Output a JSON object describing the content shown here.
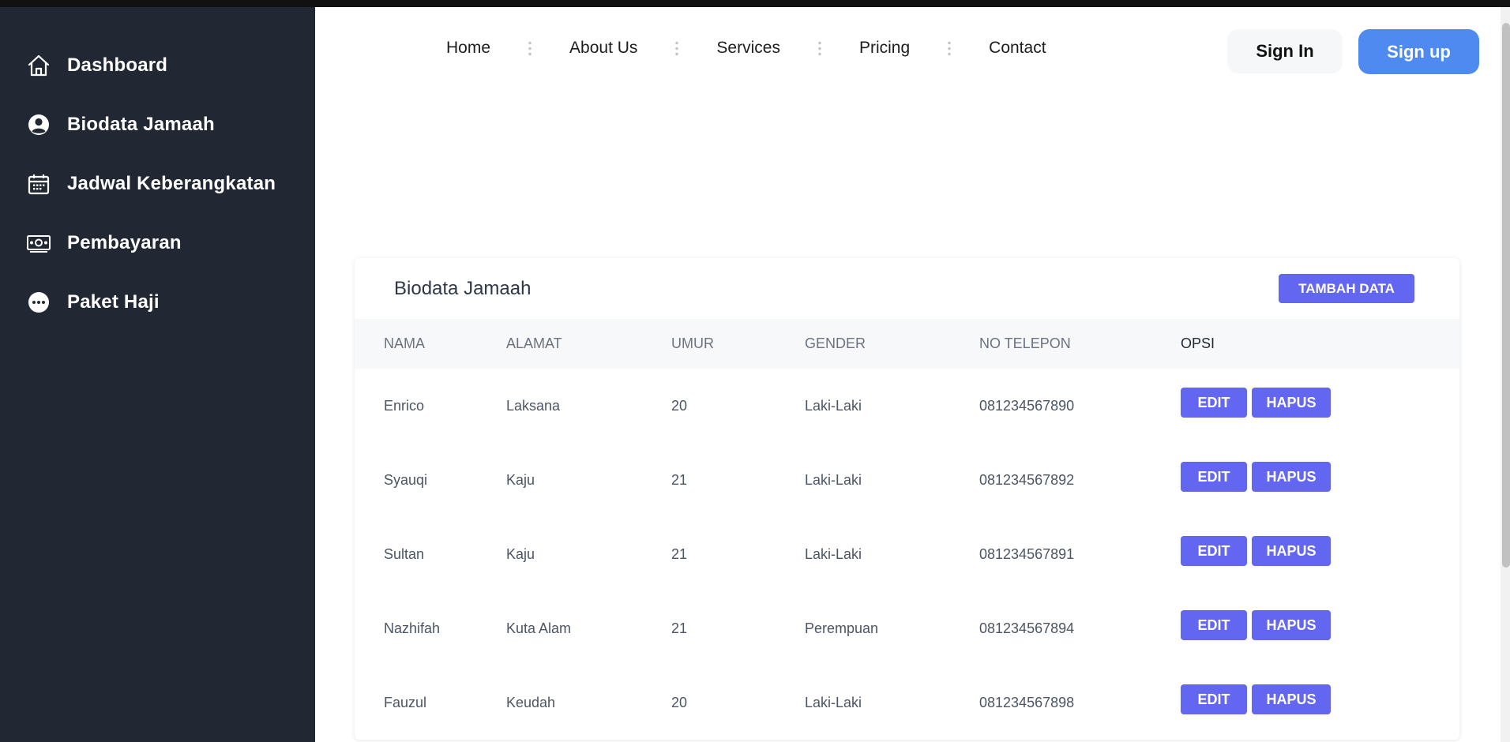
{
  "sidebar": {
    "items": [
      {
        "label": "Dashboard",
        "icon": "home-icon"
      },
      {
        "label": "Biodata Jamaah",
        "icon": "user-circle-icon"
      },
      {
        "label": "Jadwal Keberangkatan",
        "icon": "calendar-icon"
      },
      {
        "label": "Pembayaran",
        "icon": "money-icon"
      },
      {
        "label": "Paket Haji",
        "icon": "more-dots-icon"
      }
    ]
  },
  "navbar": {
    "links": [
      "Home",
      "About Us",
      "Services",
      "Pricing",
      "Contact"
    ],
    "signin_label": "Sign In",
    "signup_label": "Sign up"
  },
  "card": {
    "title": "Biodata Jamaah",
    "add_label": "TAMBAH DATA",
    "columns": [
      "NAMA",
      "ALAMAT",
      "UMUR",
      "GENDER",
      "NO TELEPON",
      "OPSI"
    ],
    "rows": [
      {
        "nama": "Enrico",
        "alamat": "Laksana",
        "umur": "20",
        "gender": "Laki-Laki",
        "telepon": "081234567890"
      },
      {
        "nama": "Syauqi",
        "alamat": "Kaju",
        "umur": "21",
        "gender": "Laki-Laki",
        "telepon": "081234567892"
      },
      {
        "nama": "Sultan",
        "alamat": "Kaju",
        "umur": "21",
        "gender": "Laki-Laki",
        "telepon": "081234567891"
      },
      {
        "nama": "Nazhifah",
        "alamat": "Kuta Alam",
        "umur": "21",
        "gender": "Perempuan",
        "telepon": "081234567894"
      },
      {
        "nama": "Fauzul",
        "alamat": "Keudah",
        "umur": "20",
        "gender": "Laki-Laki",
        "telepon": "081234567898"
      }
    ],
    "edit_label": "EDIT",
    "delete_label": "HAPUS"
  },
  "colors": {
    "sidebar_bg": "#222833",
    "accent": "#6366f1",
    "signup_bg": "#4f8af0"
  }
}
